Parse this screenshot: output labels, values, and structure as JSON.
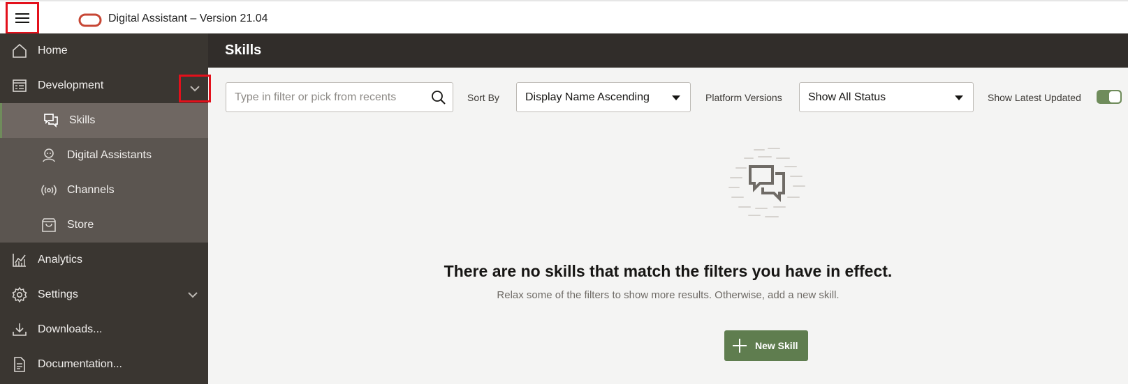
{
  "header": {
    "app_title": "Digital Assistant – Version 21.04"
  },
  "sidebar": {
    "items": [
      {
        "label": "Home",
        "icon": "home-icon"
      },
      {
        "label": "Development",
        "icon": "development-icon",
        "expanded": true
      },
      {
        "label": "Analytics",
        "icon": "analytics-icon"
      },
      {
        "label": "Settings",
        "icon": "settings-icon",
        "expanded": false
      },
      {
        "label": "Downloads...",
        "icon": "download-icon"
      },
      {
        "label": "Documentation...",
        "icon": "documentation-icon"
      }
    ],
    "development_children": [
      {
        "label": "Skills",
        "icon": "chat-icon",
        "selected": true
      },
      {
        "label": "Digital Assistants",
        "icon": "assistant-icon"
      },
      {
        "label": "Channels",
        "icon": "channels-icon"
      },
      {
        "label": "Store",
        "icon": "store-icon"
      }
    ]
  },
  "page": {
    "title": "Skills",
    "filter": {
      "placeholder": "Type in filter or pick from recents",
      "value": ""
    },
    "sort_by": {
      "label": "Sort By",
      "value": "Display Name Ascending"
    },
    "platform_versions": {
      "label": "Platform Versions",
      "value": "Show All Status"
    },
    "show_latest": {
      "label": "Show Latest Updated",
      "on": true
    },
    "empty_state": {
      "title": "There are no skills that match the filters you have in effect.",
      "subtitle": "Relax some of the filters to show more results. Otherwise, add a new skill."
    },
    "new_button": {
      "label": "New Skill"
    }
  },
  "colors": {
    "header_bg": "#ffffff",
    "sidebar_bg": "#3a3631",
    "submenu_bg": "#5b5550",
    "selected_bg": "#6f6762",
    "accent_green": "#6f8c5b",
    "button_green": "#5f7d4f",
    "brand_red": "#c74634",
    "highlight_red": "#e3101b"
  }
}
